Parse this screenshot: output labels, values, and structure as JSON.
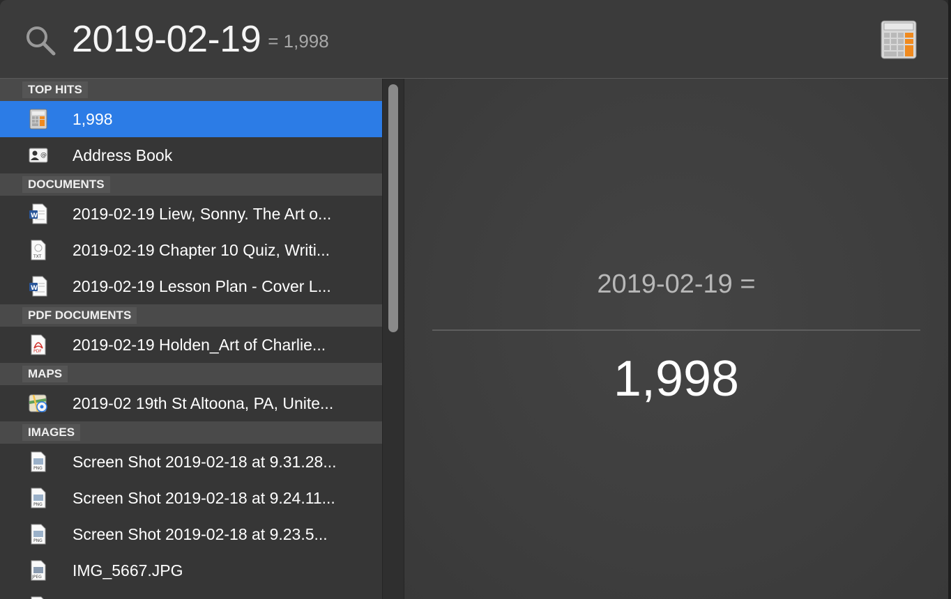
{
  "search": {
    "query": "2019-02-19",
    "inline_result": "= 1,998"
  },
  "sections": [
    {
      "header": "TOP HITS",
      "items": [
        {
          "label": "1,998",
          "icon": "calculator-icon",
          "selected": true
        },
        {
          "label": "Address Book",
          "icon": "address-book-icon",
          "selected": false
        }
      ]
    },
    {
      "header": "DOCUMENTS",
      "items": [
        {
          "label": "2019-02-19 Liew, Sonny. The Art o...",
          "icon": "word-doc-icon"
        },
        {
          "label": "2019-02-19 Chapter 10 Quiz, Writi...",
          "icon": "txt-doc-icon"
        },
        {
          "label": "2019-02-19 Lesson Plan - Cover L...",
          "icon": "word-doc-icon"
        }
      ]
    },
    {
      "header": "PDF DOCUMENTS",
      "items": [
        {
          "label": "2019-02-19 Holden_Art of Charlie...",
          "icon": "pdf-doc-icon"
        }
      ]
    },
    {
      "header": "MAPS",
      "items": [
        {
          "label": "2019-02 19th St Altoona, PA, Unite...",
          "icon": "maps-icon"
        }
      ]
    },
    {
      "header": "IMAGES",
      "items": [
        {
          "label": "Screen Shot 2019-02-18 at 9.31.28...",
          "icon": "png-file-icon"
        },
        {
          "label": "Screen Shot 2019-02-18 at 9.24.11...",
          "icon": "png-file-icon"
        },
        {
          "label": "Screen Shot 2019-02-18 at 9.23.5...",
          "icon": "png-file-icon"
        },
        {
          "label": "IMG_5667.JPG",
          "icon": "jpeg-file-icon"
        }
      ]
    }
  ],
  "preview": {
    "expression": "2019-02-19 =",
    "value": "1,998"
  },
  "colors": {
    "selection": "#2c7ce6",
    "background": "#3a3a3a"
  }
}
